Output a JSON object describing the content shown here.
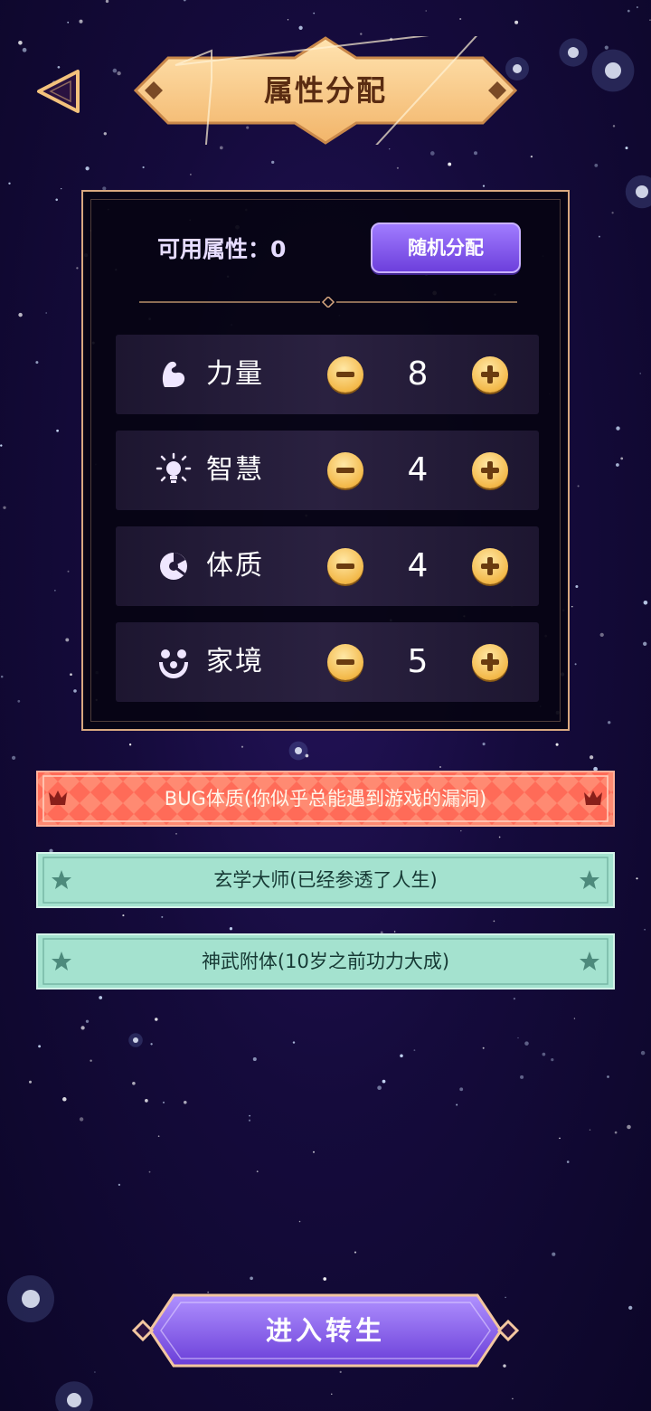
{
  "header": {
    "title": "属性分配",
    "back_icon": "back-triangle-icon"
  },
  "panel": {
    "available_label": "可用属性：",
    "available_value": "0",
    "random_button": "随机分配"
  },
  "attributes": [
    {
      "label": "力量",
      "value": "8",
      "icon": "muscle-icon"
    },
    {
      "label": "智慧",
      "value": "4",
      "icon": "lightbulb-icon"
    },
    {
      "label": "体质",
      "value": "4",
      "icon": "constitution-icon"
    },
    {
      "label": "家境",
      "value": "5",
      "icon": "family-icon"
    }
  ],
  "traits": [
    {
      "text": "BUG体质(你似乎总能遇到游戏的漏洞)",
      "style": "red",
      "icon": "crown-icon"
    },
    {
      "text": "玄学大师(已经参透了人生)",
      "style": "green",
      "icon": "star-icon"
    },
    {
      "text": "神武附体(10岁之前功力大成)",
      "style": "green",
      "icon": "star-icon"
    }
  ],
  "footer": {
    "enter_button": "进入转生"
  },
  "colors": {
    "background": "#150b3c",
    "gold": "#f7c98c",
    "purple_button": "#7d4ff0",
    "trait_red": "#ff6e5a",
    "trait_green": "#a7e3d1"
  }
}
